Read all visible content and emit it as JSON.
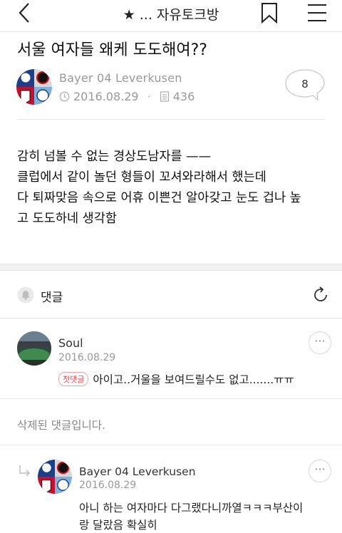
{
  "topbar": {
    "title": "★ ... 자유토크방",
    "back_icon": "chevron-left-icon",
    "bookmark_icon": "bookmark-icon",
    "menu_icon": "hamburger-menu-icon"
  },
  "post": {
    "title": "서울 여자들 왜케 도도해여??",
    "author": "Bayer 04 Leverkusen",
    "date": "2016.08.29",
    "views": "436",
    "comment_count": "8",
    "body_lines": [
      "감히 넘볼 수 없는 경상도남자를 ——",
      "클럽에서 같이 놀던 형들이 꼬셔와라해서 했는데",
      "다 퇴짜맞음 속으로 어휴 이쁜건 알아갖고 눈도 겁나 높",
      "고 도도하네 생각함"
    ]
  },
  "comments_header": {
    "label": "댓글",
    "bell_icon": "bell-icon",
    "refresh_icon": "refresh-icon"
  },
  "comments": [
    {
      "author": "Soul",
      "date": "2016.08.29",
      "badge": "첫댓글",
      "text": "아이고..거울을 보여드릴수도 없고.......ㅠㅠ"
    }
  ],
  "deleted_comment": "삭제된 댓글입니다.",
  "reply": {
    "author": "Bayer 04 Leverkusen",
    "date": "2016.08.29",
    "text_lines": [
      "아니 하는 여자마다 다그랬다니까열ㅋㅋㅋ부산이",
      "랑 달랐음 확실히"
    ]
  },
  "more_label": "···",
  "colors": {
    "accent_badge": "#e24d4d",
    "muted_text": "#9a9a9a",
    "divider": "#e6e6e6"
  }
}
